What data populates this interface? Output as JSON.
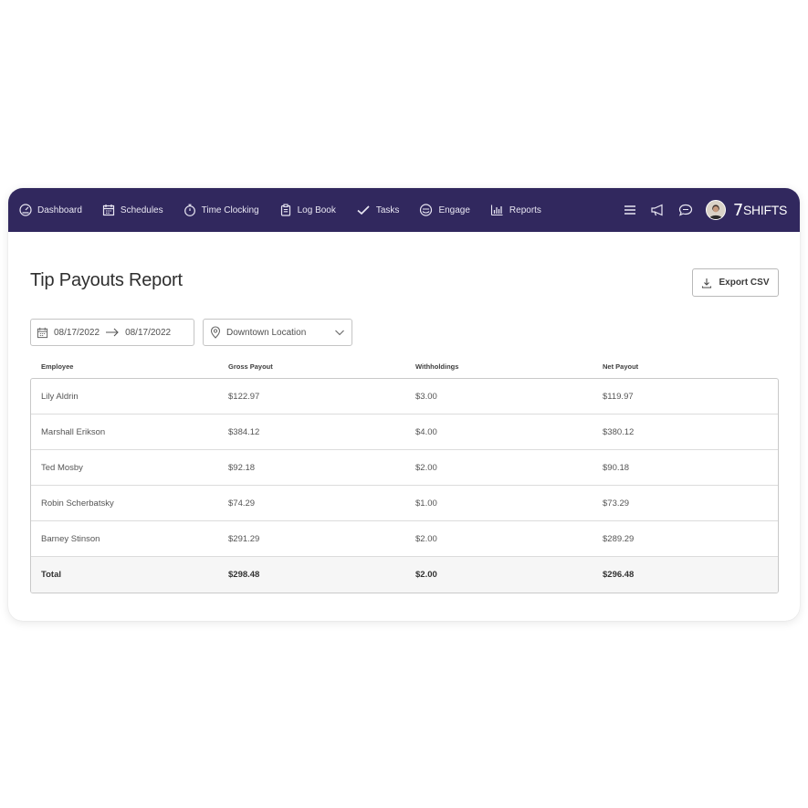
{
  "nav": {
    "items": [
      {
        "label": "Dashboard",
        "icon": "dashboard-icon"
      },
      {
        "label": "Schedules",
        "icon": "calendar-icon"
      },
      {
        "label": "Time Clocking",
        "icon": "stopwatch-icon"
      },
      {
        "label": "Log Book",
        "icon": "clipboard-icon"
      },
      {
        "label": "Tasks",
        "icon": "checkmark-icon"
      },
      {
        "label": "Engage",
        "icon": "engage-icon"
      },
      {
        "label": "Reports",
        "icon": "bar-chart-icon"
      }
    ],
    "logo": {
      "number": "7",
      "text": "SHIFTS"
    },
    "background": "#31285e"
  },
  "page": {
    "title": "Tip Payouts Report",
    "export_label": "Export CSV"
  },
  "filters": {
    "date_start": "08/17/2022",
    "date_end": "08/17/2022",
    "location": "Downtown Location"
  },
  "table": {
    "headers": [
      "Employee",
      "Gross Payout",
      "Withholdings",
      "Net Payout"
    ],
    "rows": [
      [
        "Lily Aldrin",
        "$122.97",
        "$3.00",
        "$119.97"
      ],
      [
        "Marshall Erikson",
        "$384.12",
        "$4.00",
        "$380.12"
      ],
      [
        "Ted Mosby",
        "$92.18",
        "$2.00",
        "$90.18"
      ],
      [
        "Robin Scherbatsky",
        "$74.29",
        "$1.00",
        "$73.29"
      ],
      [
        "Barney Stinson",
        "$291.29",
        "$2.00",
        "$289.29"
      ]
    ],
    "total": [
      "Total",
      "$298.48",
      "$2.00",
      "$296.48"
    ]
  }
}
